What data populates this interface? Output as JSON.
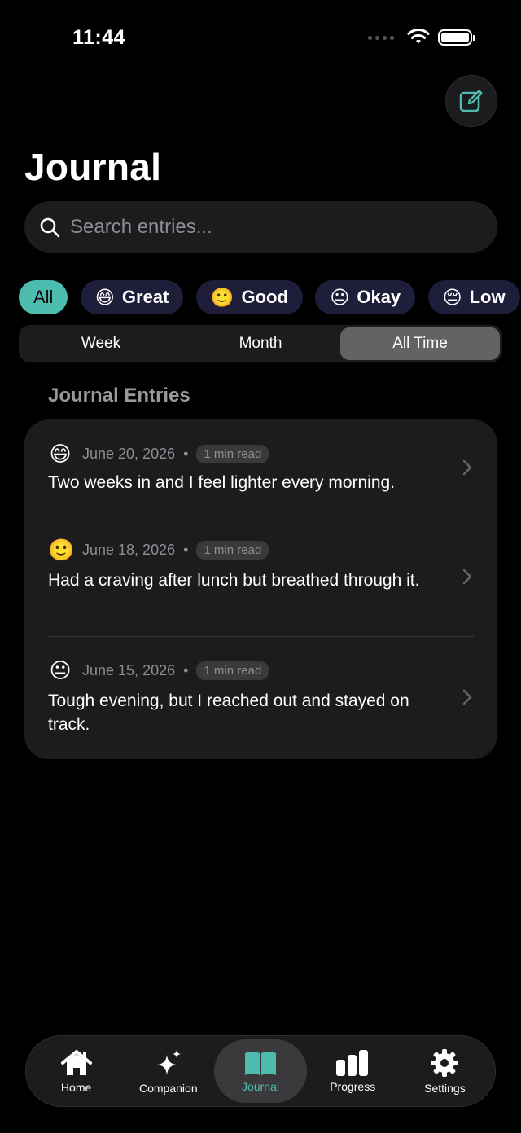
{
  "status_bar": {
    "time": "11:44"
  },
  "header": {
    "title": "Journal"
  },
  "search": {
    "placeholder": "Search entries..."
  },
  "mood_filters": [
    {
      "label": "All",
      "emoji": ""
    },
    {
      "label": "Great",
      "emoji": "😄"
    },
    {
      "label": "Good",
      "emoji": "🙂"
    },
    {
      "label": "Okay",
      "emoji": "😐"
    },
    {
      "label": "Low",
      "emoji": "😔"
    }
  ],
  "time_filter": {
    "options": [
      "Week",
      "Month",
      "All Time"
    ],
    "selected": "All Time"
  },
  "section_title": "Journal Entries",
  "entries": [
    {
      "emoji": "😄",
      "date": "June 20, 2026",
      "read_time": "1 min read",
      "text": "Two weeks in and I feel lighter every morning."
    },
    {
      "emoji": "🙂",
      "date": "June 18, 2026",
      "read_time": "1 min read",
      "text": "Had a craving after lunch but breathed through it."
    },
    {
      "emoji": "😐",
      "date": "June 15, 2026",
      "read_time": "1 min read",
      "text": "Tough evening, but I reached out and stayed on track."
    }
  ],
  "tab_bar": {
    "tabs": [
      {
        "label": "Home",
        "icon": "home-icon"
      },
      {
        "label": "Companion",
        "icon": "sparkles-icon"
      },
      {
        "label": "Journal",
        "icon": "book-icon"
      },
      {
        "label": "Progress",
        "icon": "bar-chart-icon"
      },
      {
        "label": "Settings",
        "icon": "gear-icon"
      }
    ],
    "active": "Journal"
  },
  "colors": {
    "accent": "#4bbcae",
    "background": "#000000",
    "card": "#1c1c1e",
    "chip": "#1e1e3a"
  }
}
